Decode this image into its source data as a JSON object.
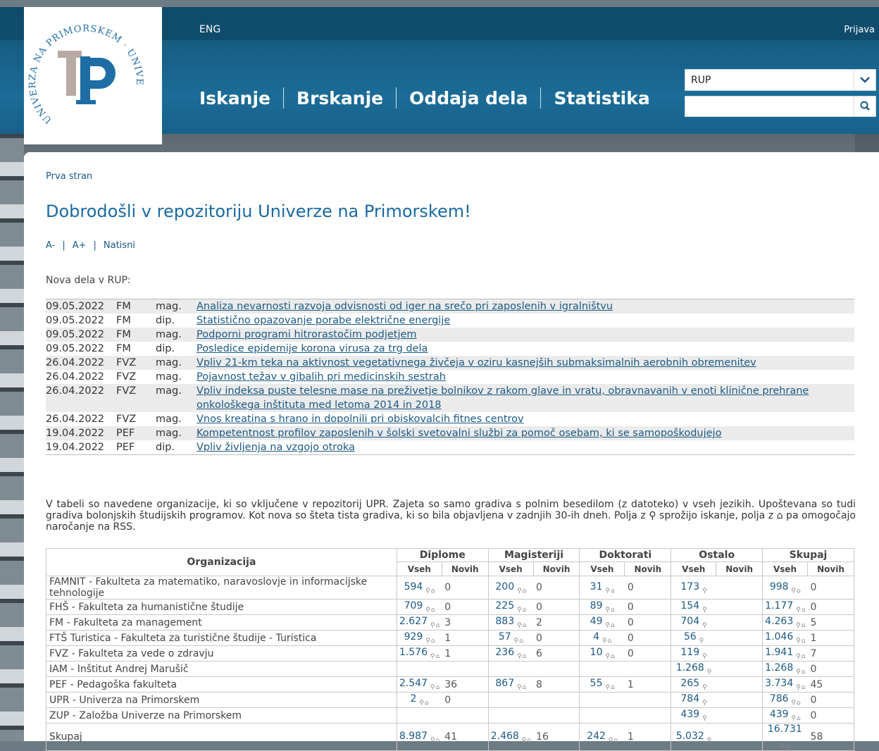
{
  "header": {
    "lang": "ENG",
    "login": "Prijava",
    "nav": [
      "Iskanje",
      "Brskanje",
      "Oddaja dela",
      "Statistika"
    ],
    "repo_select": "RUP",
    "search_placeholder": "",
    "logo_ring_text": "UNIVERZA NA PRIMORSKEM · UNIVERSITÀ DEL LITORALE"
  },
  "breadcrumb": "Prva stran",
  "title": "Dobrodošli v repozitoriju Univerze na Primorskem!",
  "tools": [
    "A-",
    "A+",
    "Natisni"
  ],
  "new_label": "Nova dela v RUP:",
  "new_items": [
    {
      "date": "09.05.2022",
      "fac": "FM",
      "type": "mag.",
      "title": "Analiza nevarnosti razvoja odvisnosti od iger na srečo pri zaposlenih v igralništvu"
    },
    {
      "date": "09.05.2022",
      "fac": "FM",
      "type": "dip.",
      "title": "Statistično opazovanje porabe električne energije"
    },
    {
      "date": "09.05.2022",
      "fac": "FM",
      "type": "mag.",
      "title": "Podporni programi hitrorastočim podjetjem"
    },
    {
      "date": "09.05.2022",
      "fac": "FM",
      "type": "dip.",
      "title": "Posledice epidemije korona virusa za trg dela"
    },
    {
      "date": "26.04.2022",
      "fac": "FVZ",
      "type": "mag.",
      "title": "Vpliv 21-km teka na aktivnost vegetativnega živčeja v oziru kasnejših submaksimalnih aerobnih obremenitev"
    },
    {
      "date": "26.04.2022",
      "fac": "FVZ",
      "type": "mag.",
      "title": "Pojavnost težav v gibalih pri medicinskih sestrah"
    },
    {
      "date": "26.04.2022",
      "fac": "FVZ",
      "type": "mag.",
      "title": "Vpliv indeksa puste telesne mase na preživetje bolnikov z rakom glave in vratu, obravnavanih v enoti klinične prehrane onkološkega inštituta med letoma 2014 in 2018"
    },
    {
      "date": "26.04.2022",
      "fac": "FVZ",
      "type": "mag.",
      "title": "Vnos kreatina s hrano in dopolnili pri obiskovalcih fitnes centrov"
    },
    {
      "date": "19.04.2022",
      "fac": "PEF",
      "type": "mag.",
      "title": "Kompetentnost profilov zaposlenih v šolski svetovalni službi za pomoč osebam, ki se samopoškodujejo"
    },
    {
      "date": "19.04.2022",
      "fac": "PEF",
      "type": "dip.",
      "title": "Vpliv življenja na vzgojo otroka"
    }
  ],
  "paragraph": "V tabeli so navedene organizacije, ki so vključene v repozitorij UPR. Zajeta so samo gradiva s polnim besedilom (z datoteko) v vseh jezikih. Upoštevana so tudi gradiva bolonjskih študijskih programov. Kot nova so šteta tista gradiva, ki so bila objavljena v zadnjih 30-ih dneh. Polja z ⚲ sprožijo iskanje, polja z ⌂ pa omogočajo naročanje na RSS.",
  "table": {
    "org_header": "Organizacija",
    "groups": [
      "Diplome",
      "Magisteriji",
      "Doktorati",
      "Ostalo",
      "Skupaj"
    ],
    "sub": [
      "Vseh",
      "Novih"
    ],
    "rows": [
      {
        "org": "FAMNIT - Fakulteta za matematiko, naravoslovje in informacijske tehnologije",
        "c": [
          "594",
          "0",
          "200",
          "0",
          "31",
          "0",
          "173",
          "",
          "998",
          "0"
        ]
      },
      {
        "org": "FHŠ - Fakulteta za humanistične študije",
        "c": [
          "709",
          "0",
          "225",
          "0",
          "89",
          "0",
          "154",
          "",
          "1.177",
          "0"
        ]
      },
      {
        "org": "FM - Fakulteta za management",
        "c": [
          "2.627",
          "3",
          "883",
          "2",
          "49",
          "0",
          "704",
          "",
          "4.263",
          "5"
        ]
      },
      {
        "org": "FTŠ Turistica - Fakulteta za turistične študije - Turistica",
        "c": [
          "929",
          "1",
          "57",
          "0",
          "4",
          "0",
          "56",
          "",
          "1.046",
          "1"
        ]
      },
      {
        "org": "FVZ - Fakulteta za vede o zdravju",
        "c": [
          "1.576",
          "1",
          "236",
          "6",
          "10",
          "0",
          "119",
          "",
          "1.941",
          "7"
        ]
      },
      {
        "org": "IAM - Inštitut Andrej Marušič",
        "c": [
          "",
          "",
          "",
          "",
          "",
          "",
          "1.268",
          "",
          "1.268",
          "0"
        ]
      },
      {
        "org": "PEF - Pedagoška fakulteta",
        "c": [
          "2.547",
          "36",
          "867",
          "8",
          "55",
          "1",
          "265",
          "",
          "3.734",
          "45"
        ]
      },
      {
        "org": "UPR - Univerza na Primorskem",
        "c": [
          "2",
          "0",
          "",
          "",
          "",
          "",
          "784",
          "",
          "786",
          "0"
        ]
      },
      {
        "org": "ZUP - Založba Univerze na Primorskem",
        "c": [
          "",
          "",
          "",
          "",
          "",
          "",
          "439",
          "",
          "439",
          "0"
        ]
      },
      {
        "org": "Skupaj",
        "c": [
          "8.987",
          "41",
          "2.468",
          "16",
          "242",
          "1",
          "5.032",
          "",
          "16.731",
          "58"
        ]
      }
    ]
  }
}
